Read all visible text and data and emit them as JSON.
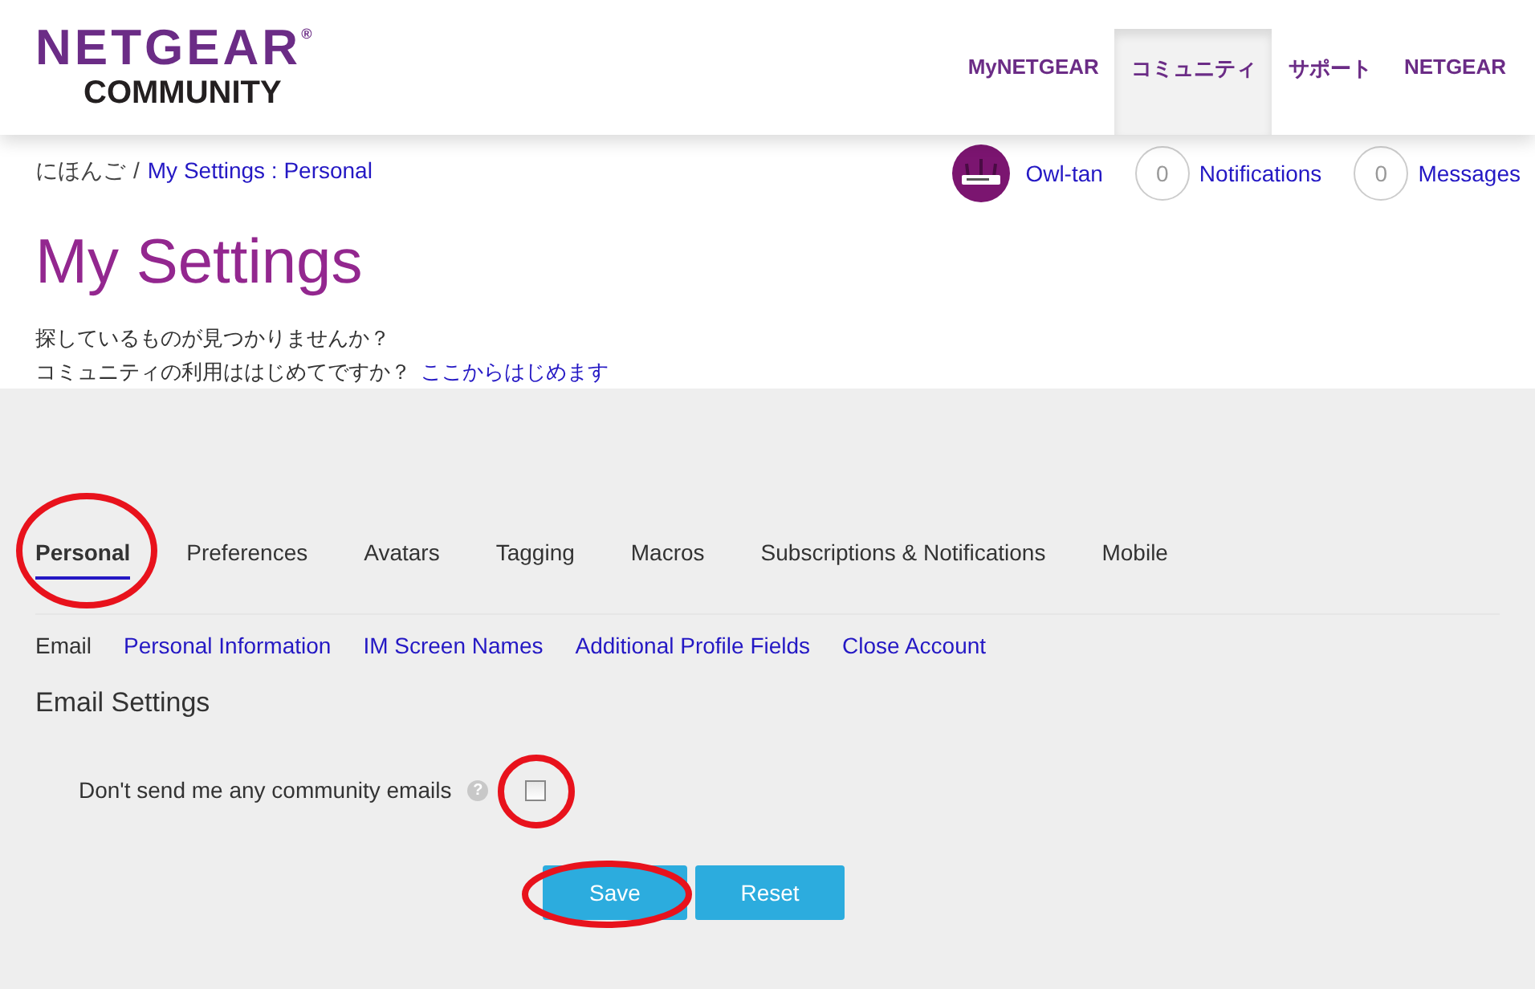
{
  "header": {
    "logo_top": "NETGEAR",
    "logo_mark": "®",
    "logo_bottom": "COMMUNITY",
    "nav": [
      {
        "label": "MyNETGEAR",
        "selected": false
      },
      {
        "label": "コミュニティ",
        "selected": true
      },
      {
        "label": "サポート",
        "selected": false
      },
      {
        "label": "NETGEAR",
        "selected": false
      }
    ]
  },
  "breadcrumb": {
    "home": "にほんご",
    "separator": "/",
    "current": "My Settings : Personal"
  },
  "user_bar": {
    "username": "Owl-tan",
    "notifications": {
      "count": "0",
      "label": "Notifications"
    },
    "messages": {
      "count": "0",
      "label": "Messages"
    }
  },
  "title": "My Settings",
  "help_lines": [
    {
      "text": "探しているものが見つかりませんか？"
    },
    {
      "text": "コミュニティの利用ははじめてですか？",
      "link": "ここからはじめます"
    }
  ],
  "tabs": [
    {
      "label": "Personal",
      "selected": true,
      "circled": true
    },
    {
      "label": "Preferences",
      "selected": false,
      "circled": false
    },
    {
      "label": "Avatars",
      "selected": false,
      "circled": false
    },
    {
      "label": "Tagging",
      "selected": false,
      "circled": false
    },
    {
      "label": "Macros",
      "selected": false,
      "circled": false
    },
    {
      "label": "Subscriptions & Notifications",
      "selected": false,
      "circled": false
    },
    {
      "label": "Mobile",
      "selected": false,
      "circled": false
    }
  ],
  "subtabs": [
    {
      "label": "Email",
      "selected": true
    },
    {
      "label": "Personal Information",
      "selected": false
    },
    {
      "label": "IM Screen Names",
      "selected": false
    },
    {
      "label": "Additional Profile Fields",
      "selected": false
    },
    {
      "label": "Close Account",
      "selected": false
    }
  ],
  "section_title": "Email Settings",
  "option": {
    "label": "Don't send me any community emails",
    "help": "?",
    "checked": false,
    "circled": true
  },
  "buttons": [
    {
      "label": "Save",
      "circled": true
    },
    {
      "label": "Reset",
      "circled": false
    }
  ]
}
